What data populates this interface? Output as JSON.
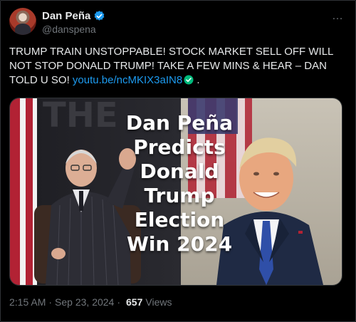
{
  "author": {
    "display_name": "Dan Peña",
    "handle": "@danspena",
    "verified_color": "#1d9bf0"
  },
  "menu": {
    "more_icon": "…"
  },
  "tweet": {
    "text_before_link": "TRUMP TRAIN UNSTOPPABLE! STOCK MARKET SELL OFF WILL NOT STOP DONALD TRUMP! TAKE A FEW MINS & HEAR – DAN TOLD U SO! ",
    "link_text": "youtu.be/ncMKIX3aIN8",
    "text_after_link": " ."
  },
  "media": {
    "headline": "Dan Peña\nPredicts\nDonald\nTrump\nElection\nWin 2024",
    "background_letters": "THE"
  },
  "meta": {
    "time": "2:15 AM",
    "separator": "·",
    "date": "Sep 23, 2024",
    "views_count": "657",
    "views_label": "Views"
  },
  "colors": {
    "background": "#000000",
    "text": "#e7e9ea",
    "muted": "#71767b",
    "link": "#1d9bf0",
    "border": "#2f3336"
  }
}
